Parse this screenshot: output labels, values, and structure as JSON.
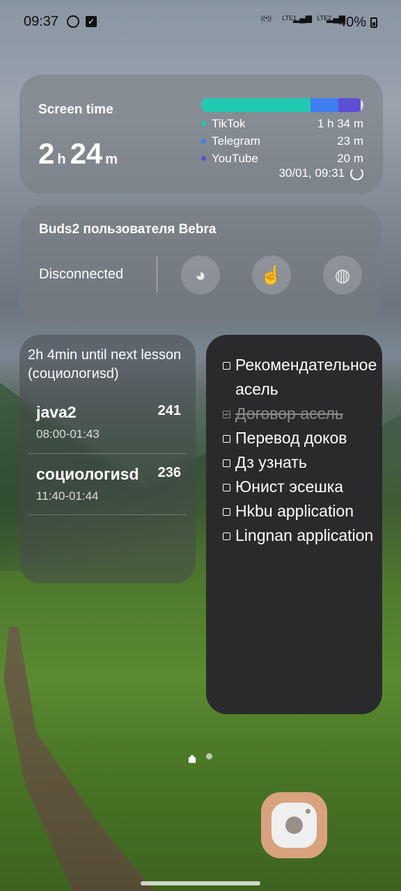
{
  "status_bar": {
    "time": "09:37",
    "battery": "40%",
    "net1": "LTE1",
    "net2": "LTE2"
  },
  "screen_time": {
    "title": "Screen time",
    "hours": "2",
    "hours_unit": "h",
    "minutes": "24",
    "minutes_unit": "m",
    "apps": [
      {
        "name": "TikTok",
        "time": "1 h 34 m",
        "color": "#20c9b0"
      },
      {
        "name": "Telegram",
        "time": "23 m",
        "color": "#3f7ff0"
      },
      {
        "name": "YouTube",
        "time": "20 m",
        "color": "#5c4fd6"
      }
    ],
    "bar_fraction": {
      "tiktok": 0.675,
      "telegram": 0.17,
      "youtube": 0.14
    },
    "updated": "30/01, 09:31"
  },
  "buds": {
    "title": "Buds2 пользователя Bebra",
    "status": "Disconnected"
  },
  "lessons": {
    "header": "2h 4min until next lesson (социологиsd)",
    "items": [
      {
        "name": "java2",
        "number": "241",
        "time": "08:00-01:43"
      },
      {
        "name": "социологиsd",
        "number": "236",
        "time": "11:40-01:44"
      }
    ]
  },
  "todo": {
    "items": [
      {
        "text": "Рекомендательное асель",
        "done": false
      },
      {
        "text": "Договор асель",
        "done": true
      },
      {
        "text": "Перевод доков",
        "done": false
      },
      {
        "text": "Дз узнать",
        "done": false
      },
      {
        "text": "Юнист эсешка",
        "done": false
      },
      {
        "text": "Hkbu application",
        "done": false
      },
      {
        "text": "Lingnan application",
        "done": false
      }
    ]
  }
}
